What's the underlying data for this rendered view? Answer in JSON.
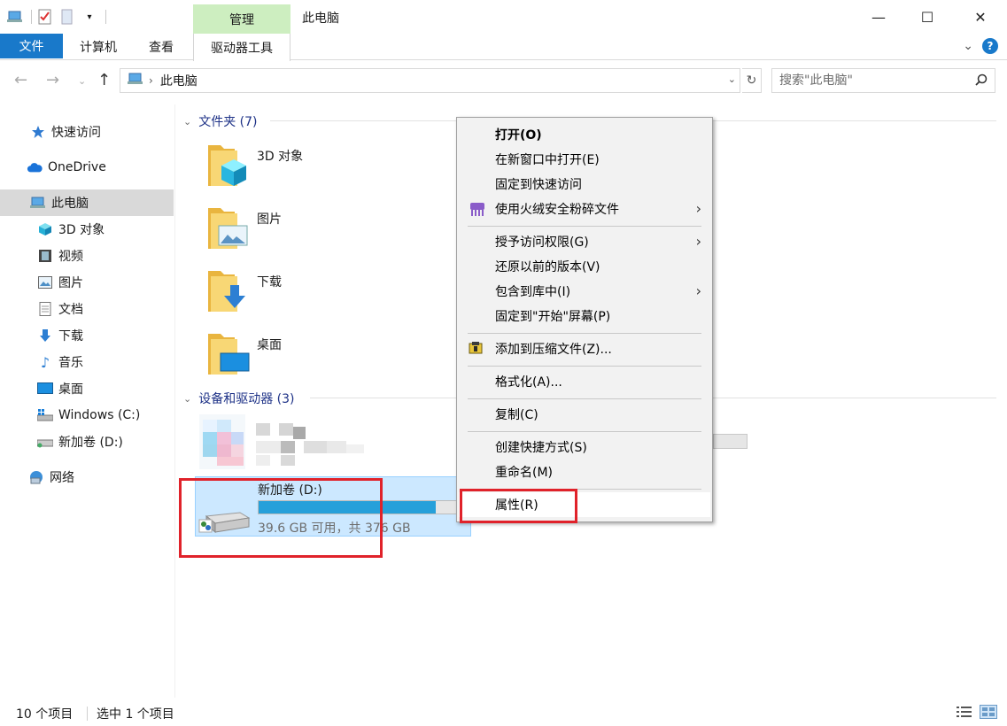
{
  "window": {
    "title": "此电脑",
    "contextual_tab_group": "管理",
    "minimize": "—",
    "maximize": "☐",
    "close": "✕"
  },
  "ribbon": {
    "tabs": [
      "文件",
      "计算机",
      "查看",
      "驱动器工具"
    ],
    "active_color": "#1979ca",
    "contextual_color": "#cdeec0"
  },
  "address": {
    "path": "此电脑",
    "search_placeholder": "搜索\"此电脑\""
  },
  "nav": {
    "items": [
      {
        "label": "快速访问",
        "icon": "star-icon"
      },
      {
        "label": "OneDrive",
        "icon": "cloud-icon"
      },
      {
        "label": "此电脑",
        "icon": "computer-icon",
        "selected": true
      },
      {
        "label": "3D 对象",
        "icon": "cube-icon"
      },
      {
        "label": "视频",
        "icon": "film-icon"
      },
      {
        "label": "图片",
        "icon": "picture-icon"
      },
      {
        "label": "文档",
        "icon": "document-icon"
      },
      {
        "label": "下载",
        "icon": "download-icon"
      },
      {
        "label": "音乐",
        "icon": "music-icon"
      },
      {
        "label": "桌面",
        "icon": "desktop-icon"
      },
      {
        "label": "Windows (C:)",
        "icon": "windows-drive-icon"
      },
      {
        "label": "新加卷 (D:)",
        "icon": "drive-icon"
      },
      {
        "label": "网络",
        "icon": "network-icon"
      }
    ]
  },
  "content": {
    "folders_header": "文件夹 (7)",
    "folders": [
      {
        "label": "3D 对象",
        "icon": "cube-folder-icon"
      },
      {
        "label": "图片",
        "icon": "picture-folder-icon"
      },
      {
        "label": "下载",
        "icon": "download-folder-icon"
      },
      {
        "label": "桌面",
        "icon": "desktop-folder-icon"
      }
    ],
    "devices_header": "设备和驱动器 (3)",
    "drive_d": {
      "name": "新加卷 (D:)",
      "free": "39.6 GB 可用，共 376 GB",
      "used_fraction": 0.895
    }
  },
  "context_menu": {
    "items": [
      {
        "label": "打开(O)",
        "bold": true
      },
      {
        "label": "在新窗口中打开(E)"
      },
      {
        "label": "固定到快速访问"
      },
      {
        "label": "使用火绒安全粉碎文件",
        "icon": "shredder-icon",
        "submenu": true
      },
      {
        "label": "授予访问权限(G)",
        "submenu": true
      },
      {
        "label": "还原以前的版本(V)"
      },
      {
        "label": "包含到库中(I)",
        "submenu": true
      },
      {
        "label": "固定到\"开始\"屏幕(P)"
      },
      {
        "label": "添加到压缩文件(Z)...",
        "icon": "archive-icon"
      },
      {
        "label": "格式化(A)..."
      },
      {
        "label": "复制(C)"
      },
      {
        "label": "创建快捷方式(S)"
      },
      {
        "label": "重命名(M)"
      },
      {
        "label": "属性(R)",
        "hover": true
      }
    ]
  },
  "status": {
    "count": "10 个项目",
    "selected": "选中 1 个项目"
  },
  "highlight_color": "#e0222a"
}
